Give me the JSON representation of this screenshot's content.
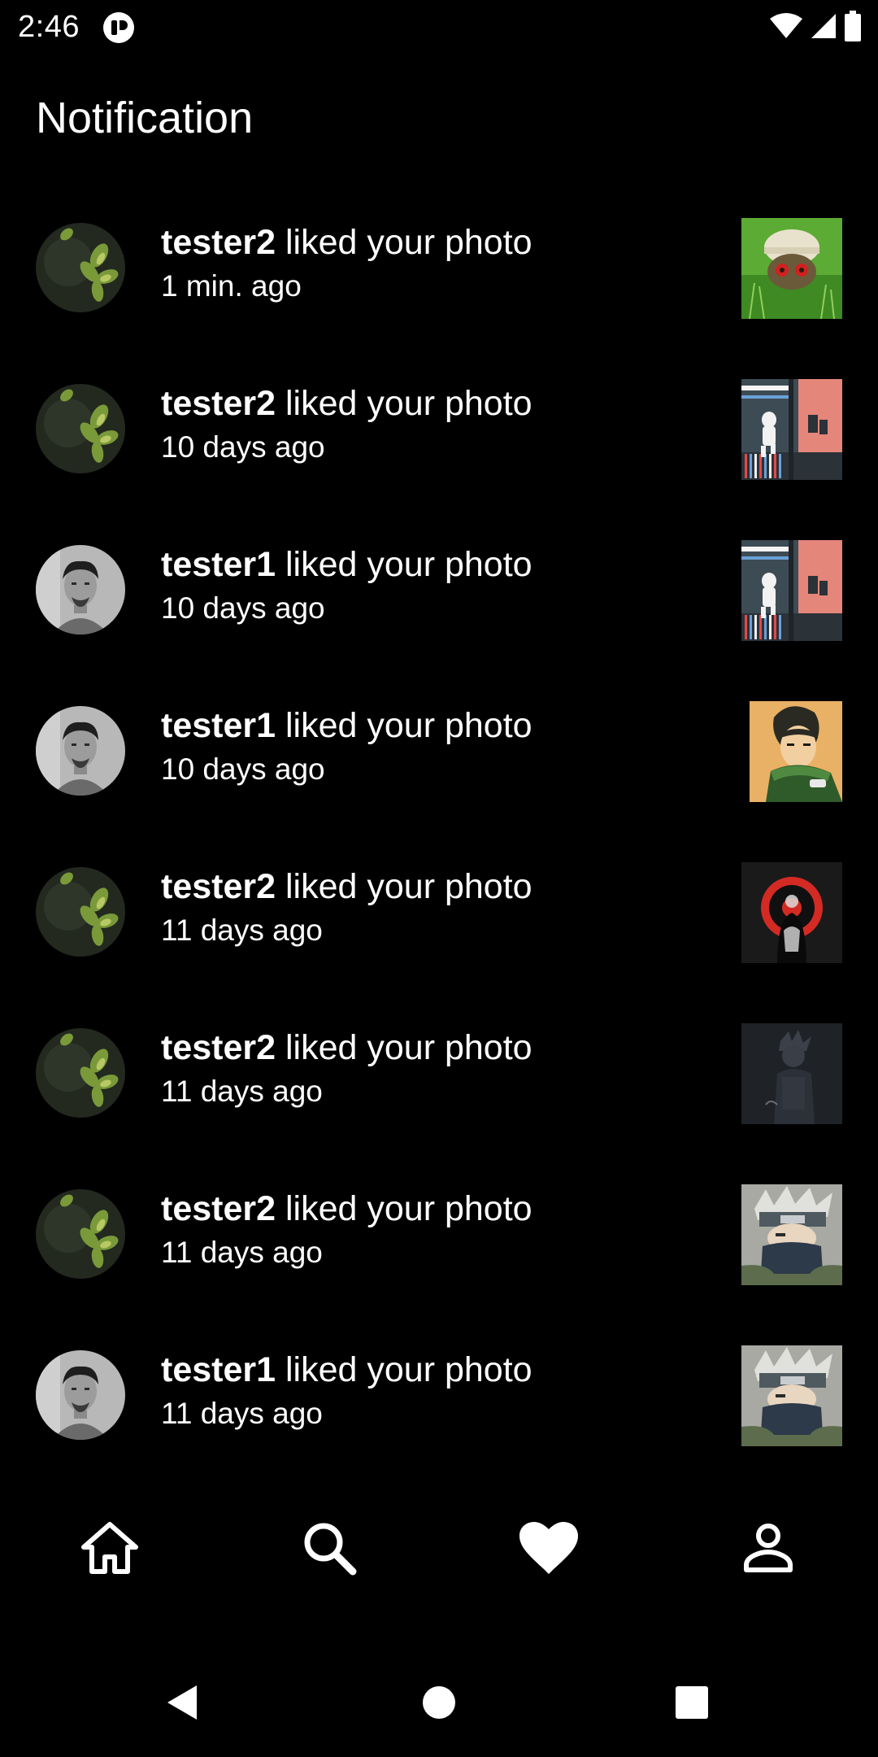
{
  "status_bar": {
    "time": "2:46",
    "icons": [
      "app-notification-icon",
      "wifi-icon",
      "signal-icon",
      "battery-icon"
    ]
  },
  "header": {
    "title": "Notification"
  },
  "notifications": [
    {
      "user": "tester2",
      "action": " liked your photo",
      "time": "1 min. ago",
      "avatar": "plant-avatar",
      "thumbnail": "hat-figure-in-grass"
    },
    {
      "user": "tester2",
      "action": " liked your photo",
      "time": "10 days ago",
      "avatar": "plant-avatar",
      "thumbnail": "comic-panel-pink"
    },
    {
      "user": "tester1",
      "action": " liked your photo",
      "time": "10 days ago",
      "avatar": "face-avatar",
      "thumbnail": "comic-panel-pink"
    },
    {
      "user": "tester1",
      "action": " liked your photo",
      "time": "10 days ago",
      "avatar": "face-avatar",
      "thumbnail": "anime-character-green-scarf"
    },
    {
      "user": "tester2",
      "action": " liked your photo",
      "time": "11 days ago",
      "avatar": "plant-avatar",
      "thumbnail": "red-circle-emblem"
    },
    {
      "user": "tester2",
      "action": " liked your photo",
      "time": "11 days ago",
      "avatar": "plant-avatar",
      "thumbnail": "dark-figure"
    },
    {
      "user": "tester2",
      "action": " liked your photo",
      "time": "11 days ago",
      "avatar": "plant-avatar",
      "thumbnail": "masked-ninja"
    },
    {
      "user": "tester1",
      "action": " liked your photo",
      "time": "11 days ago",
      "avatar": "face-avatar",
      "thumbnail": "masked-ninja"
    }
  ],
  "bottom_nav": {
    "items": [
      "home-icon",
      "search-icon",
      "heart-icon",
      "profile-icon"
    ],
    "active": "heart-icon"
  },
  "system_nav": {
    "items": [
      "back-icon",
      "home-circle-icon",
      "recents-icon"
    ]
  },
  "colors": {
    "background": "#000000",
    "text": "#ffffff"
  }
}
